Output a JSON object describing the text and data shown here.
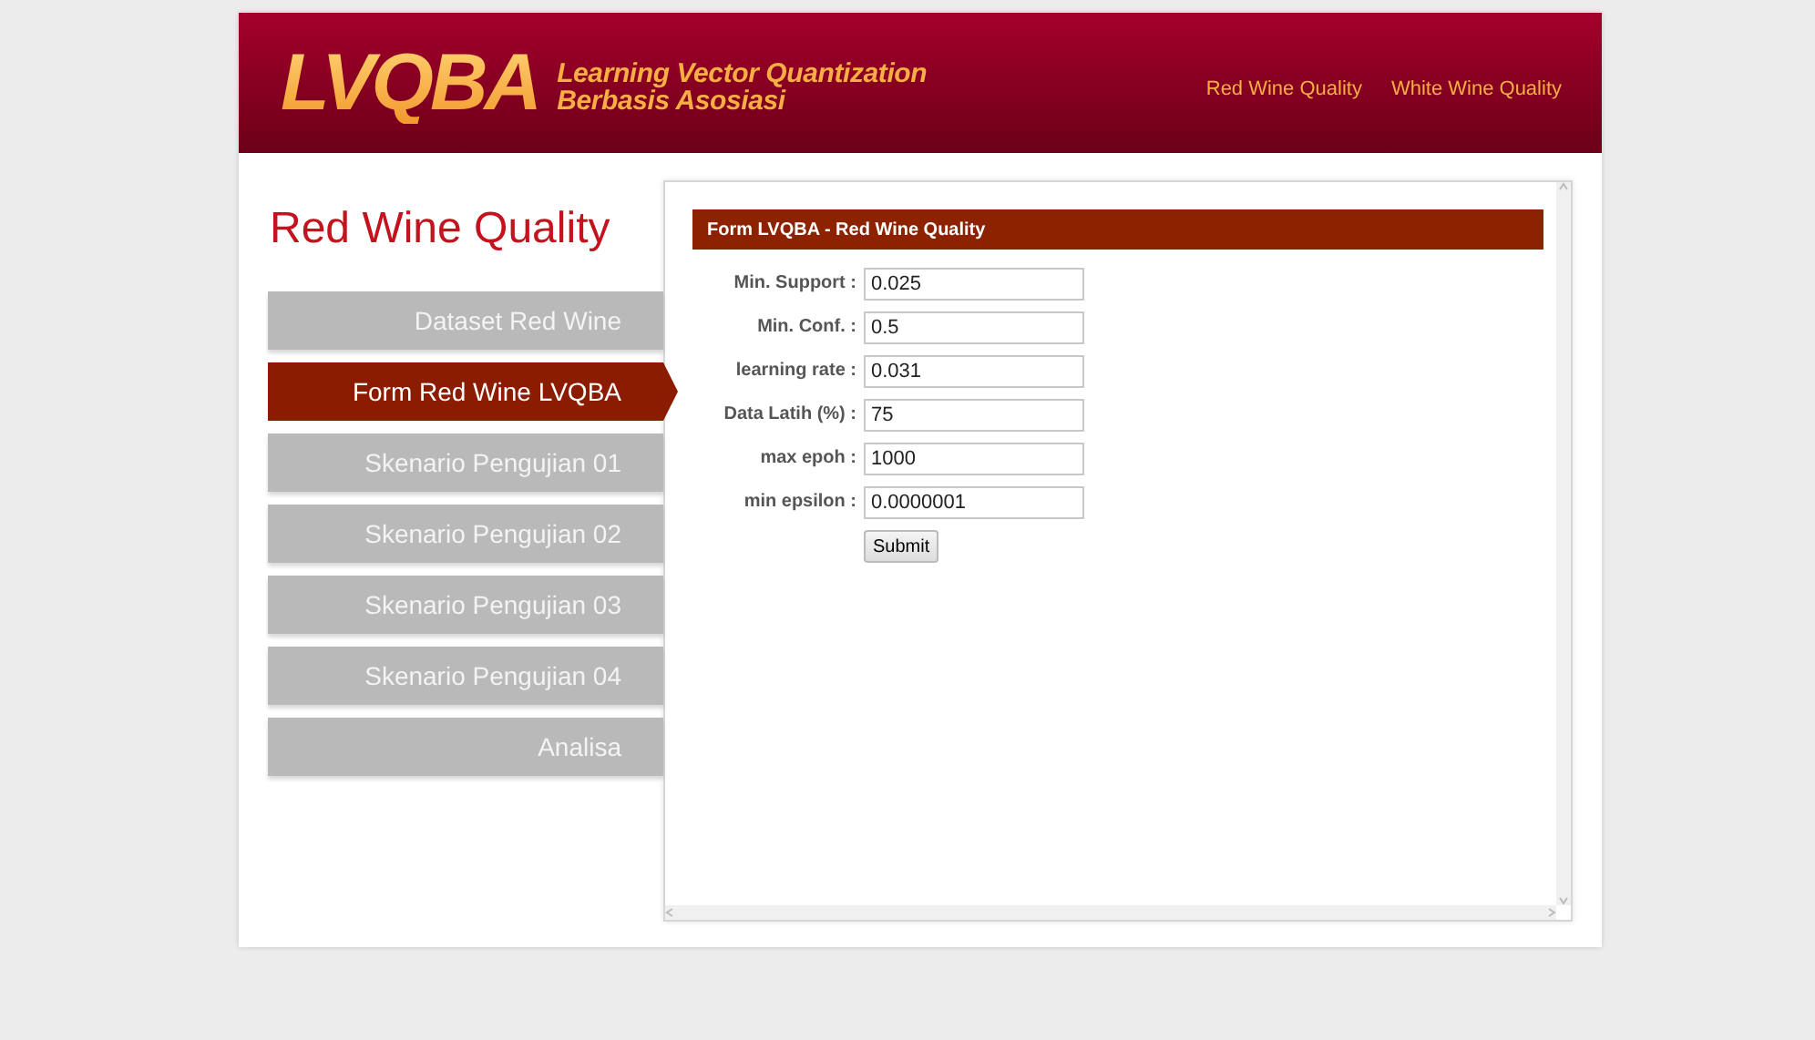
{
  "header": {
    "logo": "LVQBA",
    "tagline_1": "Learning Vector Quantization",
    "tagline_2": "Berbasis Asosiasi",
    "links": [
      {
        "label": "Red Wine Quality"
      },
      {
        "label": "White Wine Quality"
      }
    ]
  },
  "sidebar": {
    "title": "Red Wine Quality",
    "items": [
      {
        "label": "Dataset Red Wine",
        "selected": false
      },
      {
        "label": "Form Red Wine LVQBA",
        "selected": true
      },
      {
        "label": "Skenario Pengujian 01",
        "selected": false
      },
      {
        "label": "Skenario Pengujian 02",
        "selected": false
      },
      {
        "label": "Skenario Pengujian 03",
        "selected": false
      },
      {
        "label": "Skenario Pengujian 04",
        "selected": false
      },
      {
        "label": "Analisa",
        "selected": false
      }
    ]
  },
  "form": {
    "title": "Form LVQBA - Red Wine Quality",
    "fields": [
      {
        "label": "Min. Support :",
        "value": "0.025"
      },
      {
        "label": "Min. Conf. :",
        "value": "0.5"
      },
      {
        "label": "learning rate :",
        "value": "0.031"
      },
      {
        "label": "Data Latih (%) :",
        "value": "75"
      },
      {
        "label": "max epoh :",
        "value": "1000"
      },
      {
        "label": "min epsilon :",
        "value": "0.0000001"
      }
    ],
    "submit": "Submit"
  }
}
